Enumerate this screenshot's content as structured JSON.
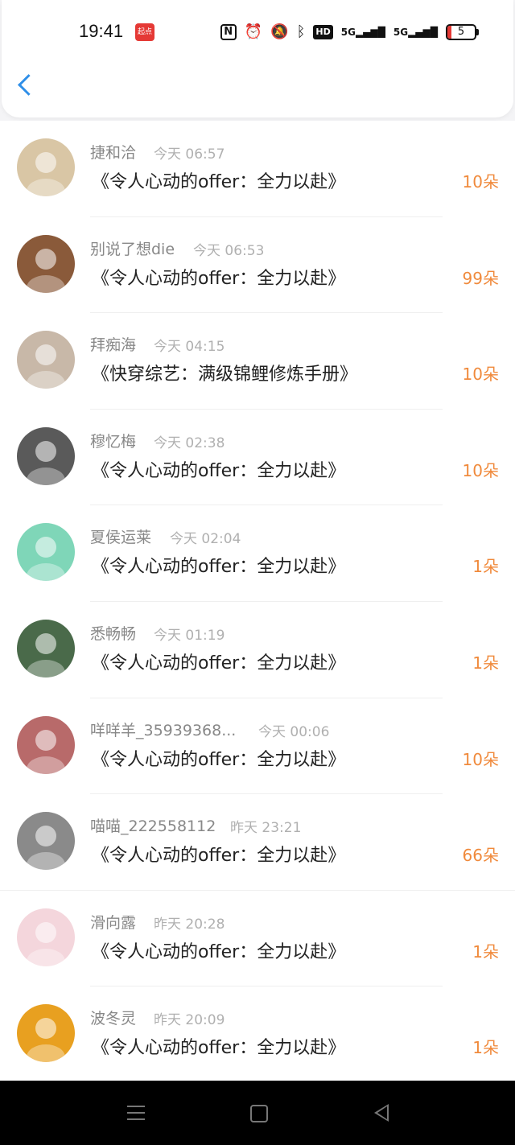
{
  "status_bar": {
    "time": "19:41",
    "app_badge": "起点",
    "icons": [
      "nfc-icon",
      "alarm-icon",
      "mute-icon",
      "bluetooth-icon",
      "hd-icon",
      "5g-signal-icon",
      "5g-signal-icon",
      "battery-icon"
    ],
    "hd": "HD",
    "sig1": "5G",
    "sig2": "5G",
    "battery": "5"
  },
  "header": {
    "back_icon": "chevron-left-icon"
  },
  "items": [
    {
      "name": "捷和洽",
      "time": "今天 06:57",
      "book": "《令人心动的offer：全力以赴》",
      "flowers": "10朵",
      "avatar_color": "#d9c6a5"
    },
    {
      "name": "别说了想die",
      "time": "今天 06:53",
      "book": "《令人心动的offer：全力以赴》",
      "flowers": "99朵",
      "avatar_color": "#8a5a3a"
    },
    {
      "name": "拜痴海",
      "time": "今天 04:15",
      "book": "《快穿综艺：满级锦鲤修炼手册》",
      "flowers": "10朵",
      "avatar_color": "#c8b8a8"
    },
    {
      "name": "穆忆梅",
      "time": "今天 02:38",
      "book": "《令人心动的offer：全力以赴》",
      "flowers": "10朵",
      "avatar_color": "#5a5a5a"
    },
    {
      "name": "夏侯运莱",
      "time": "今天 02:04",
      "book": "《令人心动的offer：全力以赴》",
      "flowers": "1朵",
      "avatar_color": "#7fd6b8"
    },
    {
      "name": "悉畅畅",
      "time": "今天 01:19",
      "book": "《令人心动的offer：全力以赴》",
      "flowers": "1朵",
      "avatar_color": "#4a6a4a"
    },
    {
      "name": "咩咩羊_35939368...",
      "time": "今天 00:06",
      "book": "《令人心动的offer：全力以赴》",
      "flowers": "10朵",
      "avatar_color": "#b86a6a"
    },
    {
      "name": "喵喵_222558112",
      "time": "昨天 23:21",
      "book": "《令人心动的offer：全力以赴》",
      "flowers": "66朵",
      "avatar_color": "#8a8a8a"
    },
    {
      "name": "滑向露",
      "time": "昨天 20:28",
      "book": "《令人心动的offer：全力以赴》",
      "flowers": "1朵",
      "avatar_color": "#f4d6dc"
    },
    {
      "name": "波冬灵",
      "time": "昨天 20:09",
      "book": "《令人心动的offer：全力以赴》",
      "flowers": "1朵",
      "avatar_color": "#e8a020"
    }
  ],
  "nav_bar": {
    "icons": [
      "menu-icon",
      "home-icon",
      "back-triangle-icon"
    ]
  }
}
